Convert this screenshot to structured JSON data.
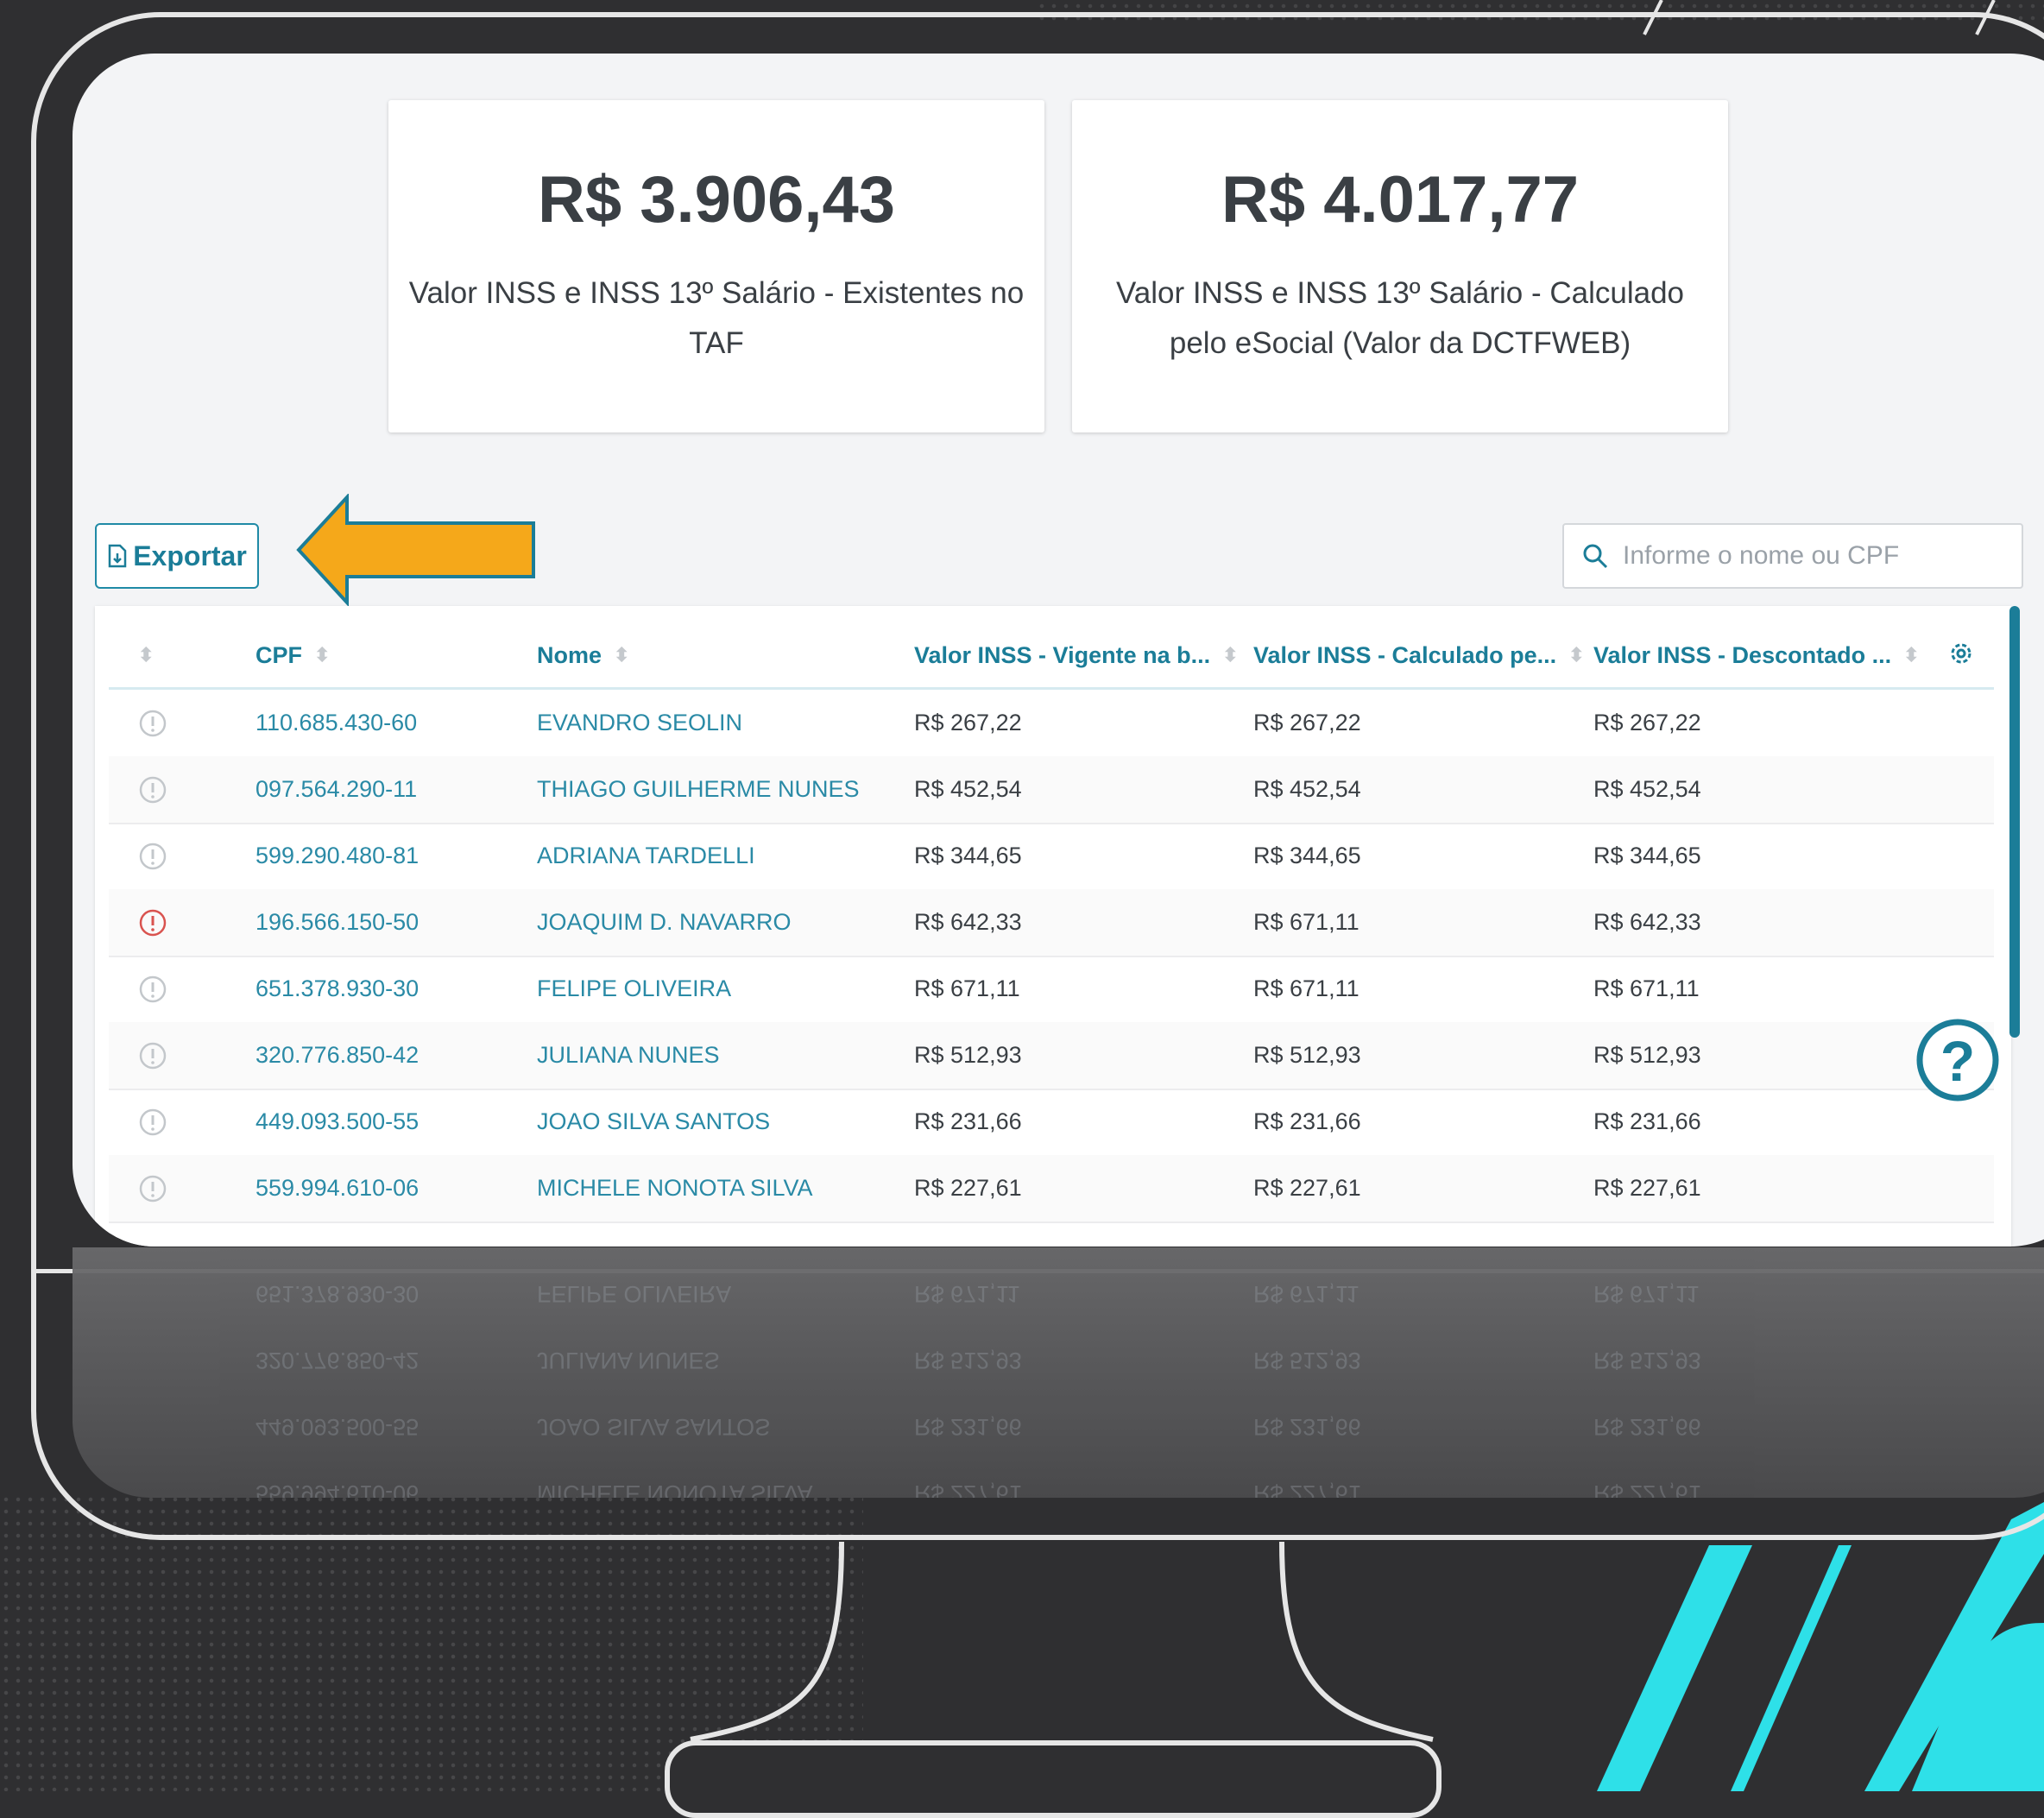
{
  "cards": [
    {
      "amount": "R$ 3.906,43",
      "description": "Valor INSS e INSS 13º Salário - Existentes no TAF"
    },
    {
      "amount": "R$ 4.017,77",
      "description": "Valor INSS e INSS 13º Salário - Calculado pelo eSocial (Valor da DCTFWEB)"
    }
  ],
  "toolbar": {
    "export_label": "Exportar"
  },
  "search": {
    "placeholder": "Informe o nome ou CPF"
  },
  "table": {
    "headers": [
      "CPF",
      "Nome",
      "Valor INSS - Vigente na b...",
      "Valor INSS - Calculado pe...",
      "Valor INSS - Descontado ..."
    ],
    "rows": [
      {
        "status": "normal",
        "cpf": "110.685.430-60",
        "nome": "EVANDRO SEOLIN",
        "v1": "R$ 267,22",
        "v2": "R$ 267,22",
        "v3": "R$ 267,22"
      },
      {
        "status": "normal",
        "cpf": "097.564.290-11",
        "nome": "THIAGO GUILHERME NUNES",
        "v1": "R$ 452,54",
        "v2": "R$ 452,54",
        "v3": "R$ 452,54"
      },
      {
        "status": "normal",
        "cpf": "599.290.480-81",
        "nome": "ADRIANA TARDELLI",
        "v1": "R$ 344,65",
        "v2": "R$ 344,65",
        "v3": "R$ 344,65"
      },
      {
        "status": "alert",
        "cpf": "196.566.150-50",
        "nome": "JOAQUIM D. NAVARRO",
        "v1": "R$ 642,33",
        "v2": "R$ 671,11",
        "v3": "R$ 642,33"
      },
      {
        "status": "normal",
        "cpf": "651.378.930-30",
        "nome": "FELIPE OLIVEIRA",
        "v1": "R$ 671,11",
        "v2": "R$ 671,11",
        "v3": "R$ 671,11"
      },
      {
        "status": "normal",
        "cpf": "320.776.850-42",
        "nome": "JULIANA NUNES",
        "v1": "R$ 512,93",
        "v2": "R$ 512,93",
        "v3": "R$ 512,93"
      },
      {
        "status": "normal",
        "cpf": "449.093.500-55",
        "nome": "JOAO SILVA SANTOS",
        "v1": "R$ 231,66",
        "v2": "R$ 231,66",
        "v3": "R$ 231,66"
      },
      {
        "status": "normal",
        "cpf": "559.994.610-06",
        "nome": "MICHELE NONOTA SILVA",
        "v1": "R$ 227,61",
        "v2": "R$ 227,61",
        "v3": "R$ 227,61"
      }
    ]
  },
  "icons": {
    "export": "file-export-icon",
    "search": "search-icon",
    "settings": "gear-icon",
    "help": "help-icon",
    "status": "info-icon",
    "arrow": "arrow-left-icon"
  },
  "colors": {
    "accent": "#1b7d98",
    "alert": "#d9534f",
    "arrow": "#f5a81a",
    "neon": "#2ee0e8"
  }
}
